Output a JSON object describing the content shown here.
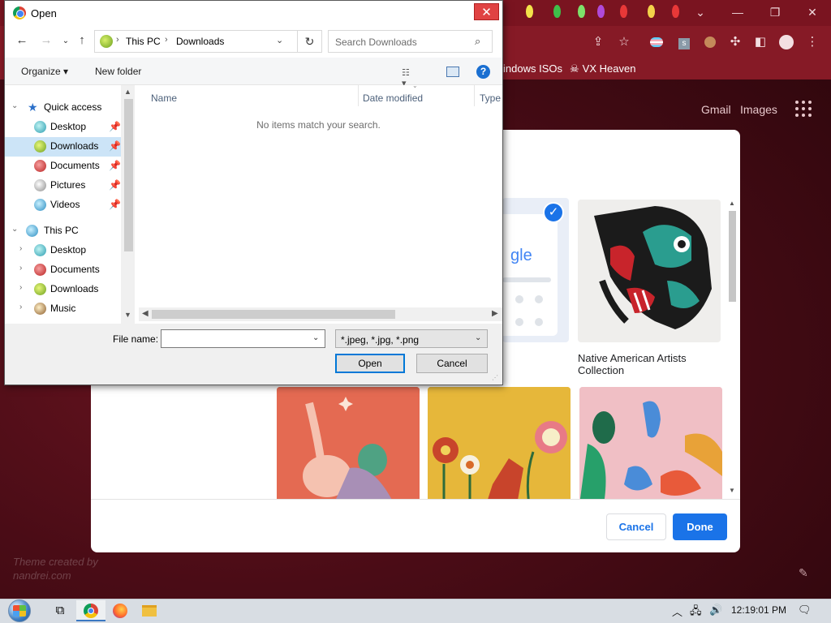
{
  "browser": {
    "bookmarks": [
      "indows ISOs",
      "VX Heaven"
    ],
    "ntp_links": {
      "gmail": "Gmail",
      "images": "Images"
    },
    "theme_credit": [
      "Theme created by",
      "nandrei.com"
    ],
    "window_controls": {
      "down": "⌄",
      "minimize": "—",
      "restore": "❐",
      "close": "✕"
    }
  },
  "customize": {
    "selected_tile_text": "gle",
    "tile_label": "Native American Artists Collection",
    "cancel_label": "Cancel",
    "done_label": "Done"
  },
  "open_dialog": {
    "title": "Open",
    "close": "✕",
    "address": {
      "segments": [
        "This PC",
        "Downloads"
      ]
    },
    "search_placeholder": "Search Downloads",
    "commands": {
      "organize": "Organize ▾",
      "new_folder": "New folder",
      "help": "?"
    },
    "columns": [
      "Name",
      "Date modified",
      "Type"
    ],
    "empty_message": "No items match your search.",
    "nav": {
      "quick_access": {
        "label": "Quick access",
        "items": [
          "Desktop",
          "Downloads",
          "Documents",
          "Pictures",
          "Videos"
        ],
        "selected": "Downloads"
      },
      "this_pc": {
        "label": "This PC",
        "items": [
          "Desktop",
          "Documents",
          "Downloads",
          "Music"
        ]
      }
    },
    "filename_label": "File name:",
    "filename_value": "",
    "filter": "*.jpeg, *.jpg, *.png",
    "open_label": "Open",
    "cancel_label": "Cancel"
  },
  "taskbar": {
    "clock": "12:19:01 PM"
  },
  "colors": {
    "chrome_frame": "#7a1420",
    "accent_blue": "#1a73e8",
    "selection": "#cce4f7",
    "taskbar": "#d8dde3"
  }
}
